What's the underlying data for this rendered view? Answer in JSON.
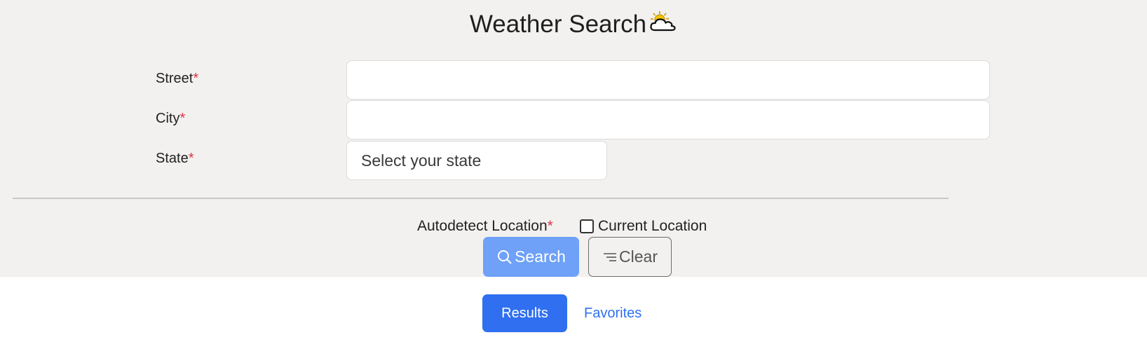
{
  "header": {
    "title": "Weather Search",
    "icon": "partly-cloudy-icon"
  },
  "form": {
    "street": {
      "label": "Street",
      "required_mark": "*",
      "value": ""
    },
    "city": {
      "label": "City",
      "required_mark": "*",
      "value": ""
    },
    "state": {
      "label": "State",
      "required_mark": "*",
      "selected": "Select your state"
    },
    "autodetect": {
      "label": "Autodetect Location",
      "required_mark": "*",
      "checkbox_label": "Current Location",
      "checked": false
    }
  },
  "buttons": {
    "search": {
      "label": "Search",
      "icon": "search-icon"
    },
    "clear": {
      "label": "Clear",
      "icon": "clear-list-icon"
    }
  },
  "tabs": {
    "results": "Results",
    "favorites": "Favorites"
  },
  "colors": {
    "primary": "#2f6ff0",
    "search_button": "#6ea1f7",
    "required": "#dc3545",
    "panel_bg": "#f2f1ef"
  }
}
